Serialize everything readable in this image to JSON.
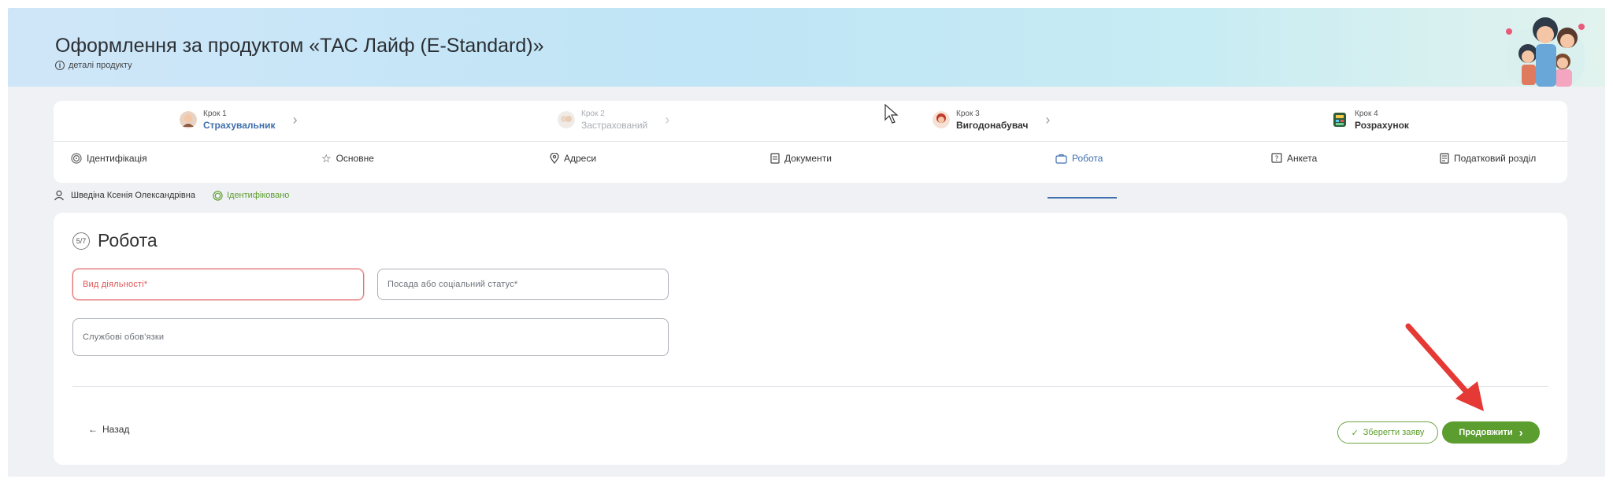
{
  "header": {
    "title": "Оформлення за продуктом «ТАС Лайф (E-Standard)»",
    "details_link": "деталі продукту",
    "info_icon_glyph": "i"
  },
  "steps": [
    {
      "label": "Крок 1",
      "name": "Страхувальник",
      "state": "active"
    },
    {
      "label": "Крок 2",
      "name": "Застрахований",
      "state": "disabled"
    },
    {
      "label": "Крок 3",
      "name": "Вигодонабувач",
      "state": "default"
    },
    {
      "label": "Крок 4",
      "name": "Розрахунок",
      "state": "default"
    }
  ],
  "tabs": [
    {
      "label": "Ідентифікація",
      "icon": "fingerprint-icon"
    },
    {
      "label": "Основне",
      "icon": "star-icon"
    },
    {
      "label": "Адреси",
      "icon": "location-pin-icon"
    },
    {
      "label": "Документи",
      "icon": "document-icon"
    },
    {
      "label": "Робота",
      "icon": "briefcase-icon",
      "active": true
    },
    {
      "label": "Анкета",
      "icon": "questionnaire-icon"
    },
    {
      "label": "Податковий розділ",
      "icon": "tax-document-icon"
    }
  ],
  "person": {
    "name": "Шведіна Ксенія Олександрівна",
    "status": "Ідентифіковано"
  },
  "form": {
    "title": "Робота",
    "title_icon_text": "5/7",
    "fields": {
      "activity_placeholder": "Вид діяльності*",
      "position_placeholder": "Посада або соціальний статус*",
      "duties_placeholder": "Службові обов'язки"
    }
  },
  "footer": {
    "back_label": "Назад",
    "save_label": "Зберегти заяву",
    "next_label": "Продовжити"
  },
  "colors": {
    "accent_blue": "#3f6fae",
    "success_green": "#5b9d2e",
    "error_red": "#e05353",
    "annotation_arrow": "#e53935"
  }
}
